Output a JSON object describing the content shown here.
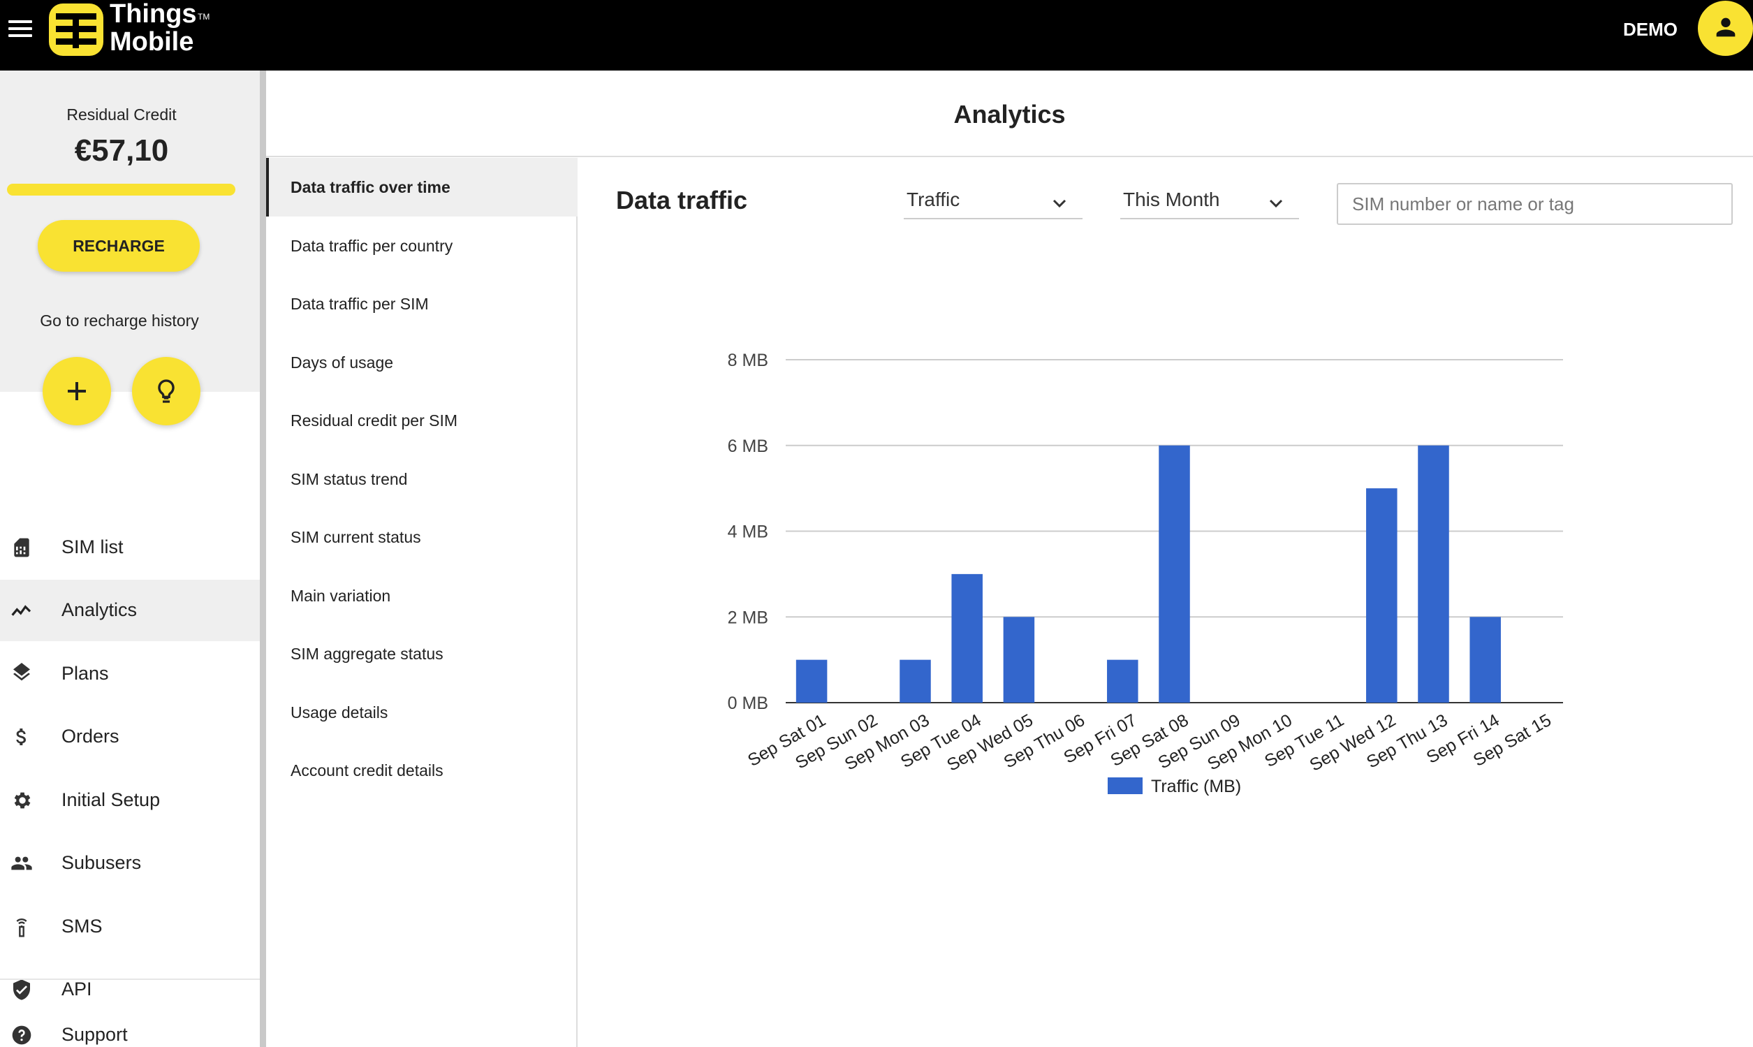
{
  "app": {
    "logo_line1": "Things",
    "logo_tm": "TM",
    "logo_line2": "Mobile",
    "account_label": "DEMO",
    "brand_color": "#f9e232"
  },
  "sidebar": {
    "credit_label": "Residual Credit",
    "credit_value": "€57,10",
    "credit_level_percent": 100,
    "recharge_label": "RECHARGE",
    "recharge_history_label": "Go to recharge history",
    "quick_actions": [
      {
        "icon": "plus-icon"
      },
      {
        "icon": "lightbulb-icon"
      }
    ],
    "items": [
      {
        "label": "SIM list",
        "icon": "sim-card-icon",
        "active": false
      },
      {
        "label": "Analytics",
        "icon": "trending-line-icon",
        "active": true
      },
      {
        "label": "Plans",
        "icon": "layers-icon",
        "active": false
      },
      {
        "label": "Orders",
        "icon": "dollar-icon",
        "active": false
      },
      {
        "label": "Initial Setup",
        "icon": "gear-icon",
        "active": false
      },
      {
        "label": "Subusers",
        "icon": "people-icon",
        "active": false
      },
      {
        "label": "SMS",
        "icon": "antenna-icon",
        "active": false
      },
      {
        "label": "API",
        "icon": "shield-check-icon",
        "active": false
      }
    ],
    "support": {
      "label": "Support",
      "icon": "help-icon"
    }
  },
  "main": {
    "page_title": "Analytics",
    "submenu": [
      {
        "label": "Data traffic over time",
        "active": true
      },
      {
        "label": "Data traffic per country",
        "active": false
      },
      {
        "label": "Data traffic per SIM",
        "active": false
      },
      {
        "label": "Days of usage",
        "active": false
      },
      {
        "label": "Residual credit per SIM",
        "active": false
      },
      {
        "label": "SIM status trend",
        "active": false
      },
      {
        "label": "SIM current status",
        "active": false
      },
      {
        "label": "Main variation",
        "active": false
      },
      {
        "label": "SIM aggregate status",
        "active": false
      },
      {
        "label": "Usage details",
        "active": false
      },
      {
        "label": "Account credit details",
        "active": false
      }
    ],
    "content_title": "Data traffic",
    "metric_select": {
      "value": "Traffic"
    },
    "period_select": {
      "value": "This Month"
    },
    "search": {
      "placeholder": "SIM number or name or tag",
      "value": ""
    }
  },
  "chart_data": {
    "type": "bar",
    "categories": [
      "Sep Sat 01",
      "Sep Sun 02",
      "Sep Mon 03",
      "Sep Tue 04",
      "Sep Wed 05",
      "Sep Thu 06",
      "Sep Fri 07",
      "Sep Sat 08",
      "Sep Sun 09",
      "Sep Mon 10",
      "Sep Tue 11",
      "Sep Wed 12",
      "Sep Thu 13",
      "Sep Fri 14",
      "Sep Sat 15"
    ],
    "series": [
      {
        "name": "Traffic (MB)",
        "values": [
          1,
          0,
          1,
          3,
          2,
          0,
          1,
          6,
          0,
          0,
          0,
          5,
          6,
          2,
          0
        ],
        "color": "#3366cc"
      }
    ],
    "ylim": [
      0,
      8
    ],
    "yticks": [
      0,
      2,
      4,
      6,
      8
    ],
    "ytick_labels": [
      "0 MB",
      "2 MB",
      "4 MB",
      "6 MB",
      "8 MB"
    ],
    "grid": true,
    "legend_position": "bottom",
    "title": "",
    "xlabel": "",
    "ylabel": ""
  }
}
